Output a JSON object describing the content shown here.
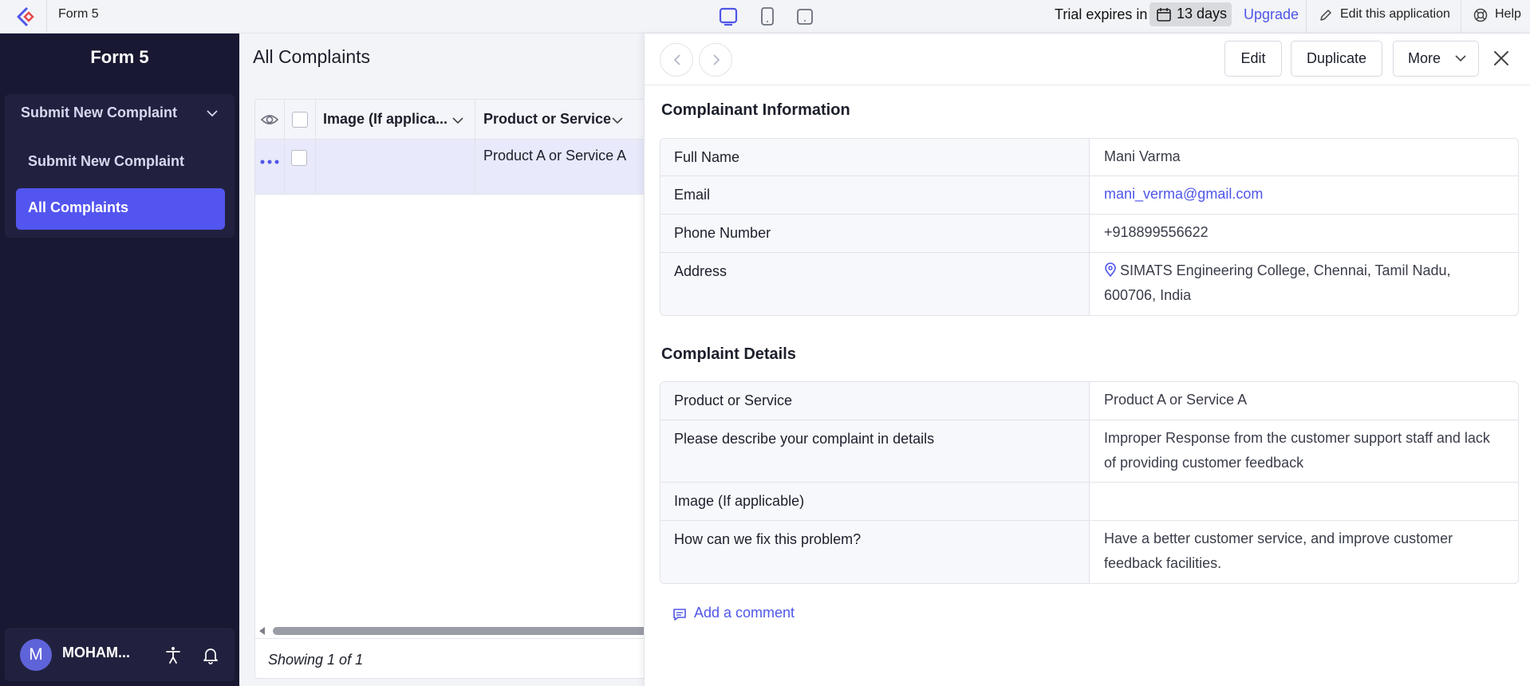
{
  "topbar": {
    "app_name": "Form 5",
    "trial_label": "Trial expires in",
    "trial_days": "13 days",
    "upgrade_label": "Upgrade",
    "edit_app_label": "Edit this application",
    "help_label": "Help",
    "device_icons": [
      "desktop-icon",
      "tablet-icon",
      "mobile-icon"
    ]
  },
  "sidebar": {
    "form_title": "Form 5",
    "group_label": "Submit New Complaint",
    "items": [
      {
        "label": "Submit New Complaint",
        "active": false
      },
      {
        "label": "All Complaints",
        "active": true
      }
    ],
    "user": {
      "initial": "M",
      "name": "MOHAM..."
    }
  },
  "main": {
    "title": "All Complaints",
    "columns": [
      "Image (If applica...",
      "Product or Service"
    ],
    "rows": [
      {
        "image": "",
        "product": "Product A or Service A"
      }
    ],
    "footer": "Showing 1 of 1"
  },
  "detail": {
    "buttons": {
      "edit": "Edit",
      "duplicate": "Duplicate",
      "more": "More"
    },
    "sections": [
      {
        "title": "Complainant Information",
        "fields": [
          {
            "label": "Full Name",
            "value": "Mani Varma"
          },
          {
            "label": "Email",
            "value": "mani_verma@gmail.com"
          },
          {
            "label": "Phone Number",
            "value": "+918899556622"
          },
          {
            "label": "Address",
            "value": "SIMATS Engineering College, Chennai, Tamil Nadu, 600706, India"
          }
        ]
      },
      {
        "title": "Complaint Details",
        "fields": [
          {
            "label": "Product or Service",
            "value": "Product A or Service A"
          },
          {
            "label": "Please describe your complaint in details",
            "value": "Improper Response from the customer support staff and lack of providing customer feedback"
          },
          {
            "label": "Image (If applicable)",
            "value": ""
          },
          {
            "label": "How can we fix this problem?",
            "value": "Have a better customer service, and improve customer feedback facilities."
          }
        ]
      }
    ],
    "add_comment": "Add a comment"
  },
  "colors": {
    "accent": "#5355f0",
    "link": "#4f56e8",
    "sidebar_bg": "#181832",
    "selected_row": "#e8e9fa"
  }
}
